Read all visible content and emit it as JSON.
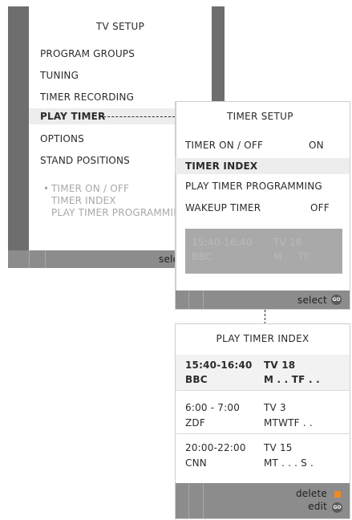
{
  "tv_setup": {
    "title": "TV SETUP",
    "items": [
      "PROGRAM GROUPS",
      "TUNING",
      "TIMER RECORDING",
      "PLAY TIMER",
      "OPTIONS",
      "STAND POSITIONS"
    ],
    "submenu": {
      "bullet": "•",
      "items": [
        "TIMER ON / OFF",
        "TIMER INDEX",
        "PLAY TIMER PROGRAMMING"
      ]
    },
    "footer_label": "select"
  },
  "timer_setup": {
    "title": "TIMER SETUP",
    "rows": [
      {
        "label": "TIMER ON / OFF",
        "value": "ON"
      },
      {
        "label": "TIMER INDEX",
        "value": ""
      },
      {
        "label": "PLAY TIMER PROGRAMMING",
        "value": ""
      },
      {
        "label": "WAKEUP TIMER",
        "value": "OFF"
      }
    ],
    "preview": {
      "time": "15:40-16:40",
      "source": "TV 18",
      "channel": "BBC",
      "days": "M . . TF . ."
    },
    "footer_label": "select",
    "go_icon_text": "GO"
  },
  "play_timer_index": {
    "title": "PLAY TIMER INDEX",
    "entries": [
      {
        "time": "15:40-16:40",
        "source": "TV 18",
        "channel": "BBC",
        "days": "M . . TF . ."
      },
      {
        "time": "6:00 - 7:00",
        "source": "TV  3",
        "channel": "ZDF",
        "days": "MTWTF . ."
      },
      {
        "time": "20:00-22:00",
        "source": "TV 15",
        "channel": "CNN",
        "days": "MT . . . S ."
      }
    ],
    "footer": {
      "delete_label": "delete",
      "edit_label": "edit"
    },
    "go_icon_text": "GO"
  },
  "colors": {
    "edge": "#6e6e6e",
    "footer": "#8c8c8c",
    "highlight": "#ededed",
    "delete_icon": "#f08a24"
  }
}
